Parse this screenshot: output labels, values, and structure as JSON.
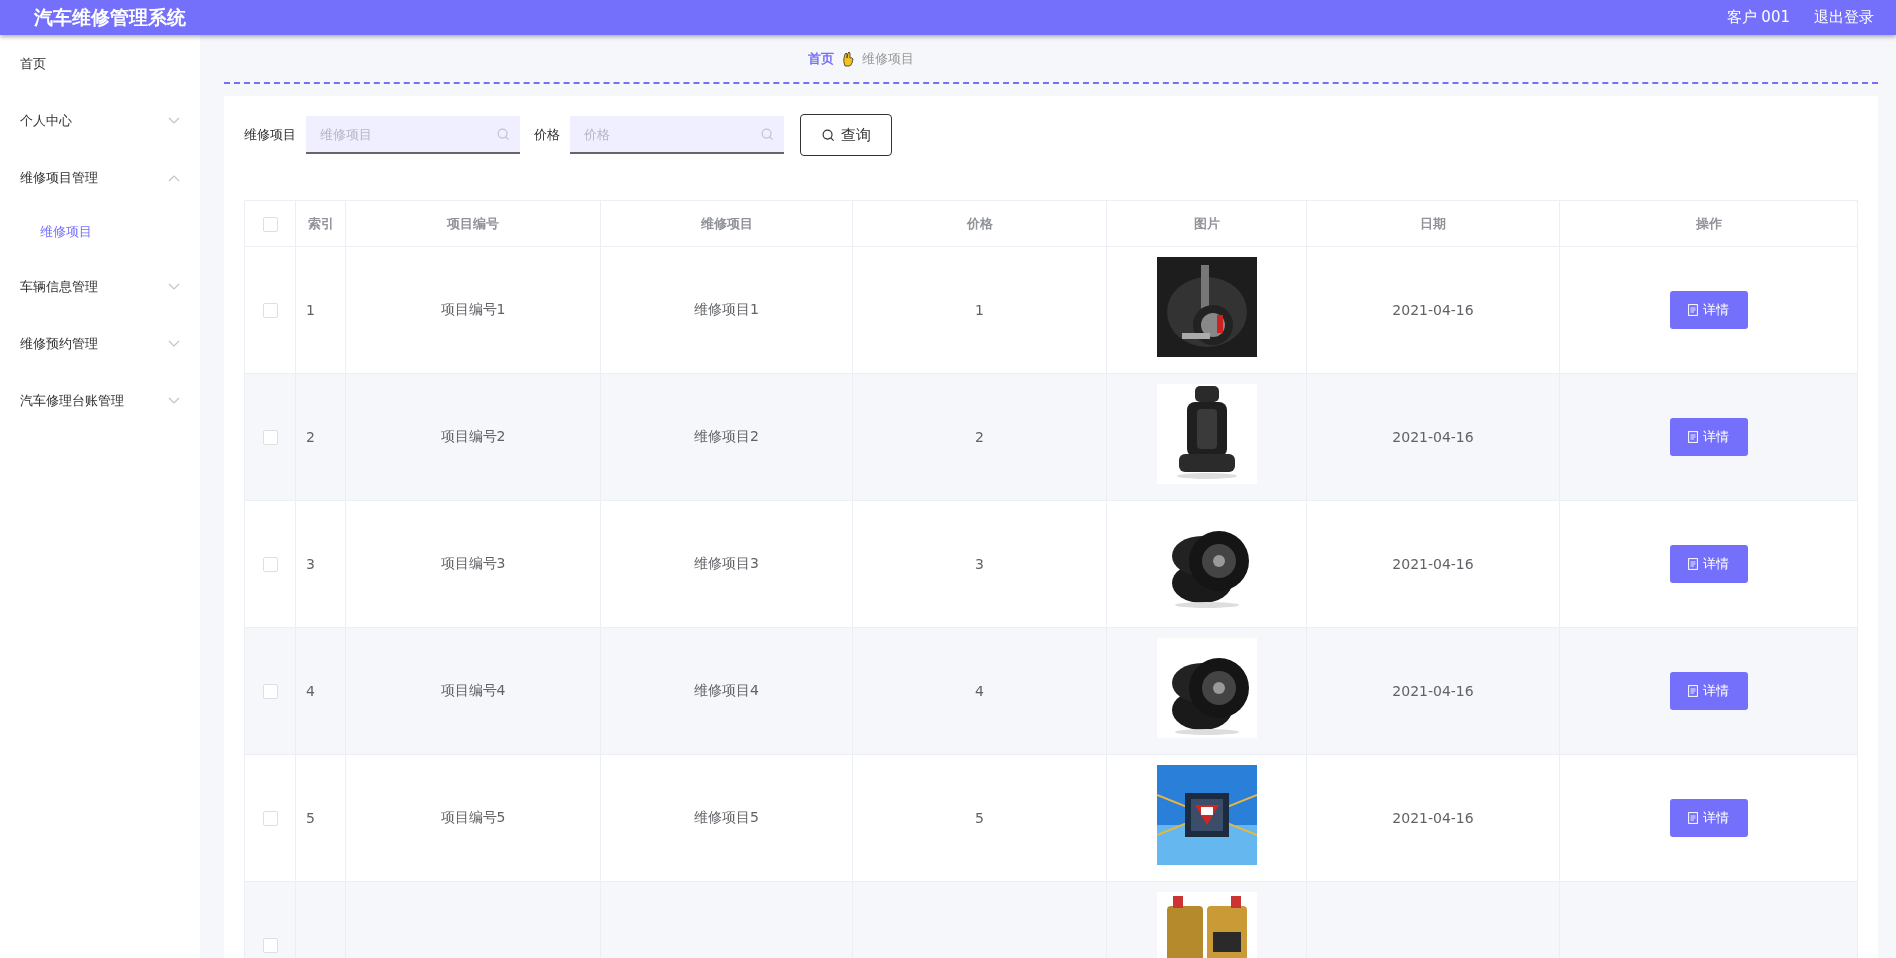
{
  "header": {
    "title": "汽车维修管理系统",
    "user": "客户 001",
    "logout": "退出登录"
  },
  "sidebar": {
    "items": [
      {
        "label": "首页"
      },
      {
        "label": "个人中心",
        "expanded": false
      },
      {
        "label": "维修项目管理",
        "expanded": true,
        "children": [
          {
            "label": "维修项目",
            "selected": true
          }
        ]
      },
      {
        "label": "车辆信息管理",
        "expanded": false
      },
      {
        "label": "维修预约管理",
        "expanded": false
      },
      {
        "label": "汽车修理台账管理",
        "expanded": false
      }
    ]
  },
  "breadcrumb": {
    "home": "首页",
    "current": "维修项目"
  },
  "search": {
    "fields": [
      {
        "label": "维修项目",
        "placeholder": "维修项目"
      },
      {
        "label": "价格",
        "placeholder": "价格"
      }
    ],
    "button": "查询"
  },
  "table": {
    "all_checked": false,
    "columns": [
      "索引",
      "项目编号",
      "维修项目",
      "价格",
      "图片",
      "日期",
      "操作"
    ],
    "rows": [
      {
        "checked": false,
        "index": "1",
        "code": "项目编号1",
        "item": "维修项目1",
        "price": "1",
        "date": "2021-04-16",
        "action": "详情"
      },
      {
        "checked": false,
        "index": "2",
        "code": "项目编号2",
        "item": "维修项目2",
        "price": "2",
        "date": "2021-04-16",
        "action": "详情"
      },
      {
        "checked": false,
        "index": "3",
        "code": "项目编号3",
        "item": "维修项目3",
        "price": "3",
        "date": "2021-04-16",
        "action": "详情"
      },
      {
        "checked": false,
        "index": "4",
        "code": "项目编号4",
        "item": "维修项目4",
        "price": "4",
        "date": "2021-04-16",
        "action": "详情"
      },
      {
        "checked": false,
        "index": "5",
        "code": "项目编号5",
        "item": "维修项目5",
        "price": "5",
        "date": "2021-04-16",
        "action": "详情"
      },
      {
        "checked": false
      }
    ]
  }
}
